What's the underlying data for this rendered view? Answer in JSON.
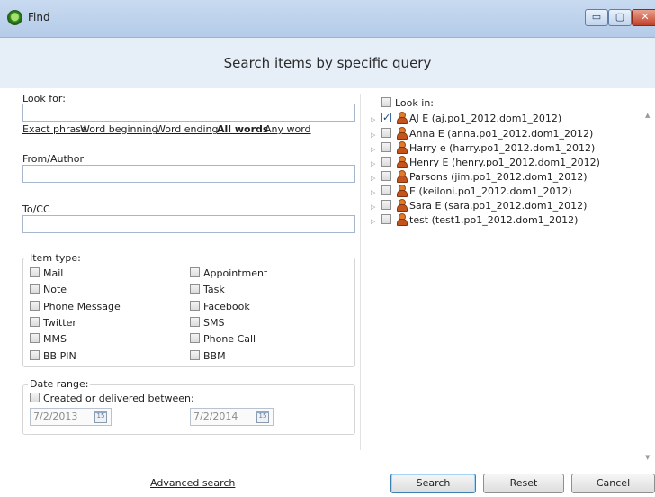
{
  "window": {
    "title": "Find"
  },
  "titlebar_buttons": {
    "minimize": "▭",
    "maximize": "▢",
    "close": "✕"
  },
  "heading": "Search items by specific query",
  "look_for": {
    "label": "Look for:",
    "value": ""
  },
  "match_options": [
    {
      "label": "Exact phrase",
      "selected": false
    },
    {
      "label": "Word beginning",
      "selected": false
    },
    {
      "label": "Word ending",
      "selected": false
    },
    {
      "label": "All words",
      "selected": true
    },
    {
      "label": "Any word",
      "selected": false
    }
  ],
  "from_author": {
    "label": "From/Author",
    "value": ""
  },
  "to_cc": {
    "label": "To/CC",
    "value": ""
  },
  "item_type": {
    "title": "Item type:",
    "items": [
      {
        "label": "Mail",
        "checked": false
      },
      {
        "label": "Appointment",
        "checked": false
      },
      {
        "label": "Note",
        "checked": false
      },
      {
        "label": "Task",
        "checked": false
      },
      {
        "label": "Phone Message",
        "checked": false
      },
      {
        "label": "Facebook",
        "checked": false
      },
      {
        "label": "Twitter",
        "checked": false
      },
      {
        "label": "SMS",
        "checked": false
      },
      {
        "label": "MMS",
        "checked": false
      },
      {
        "label": "Phone Call",
        "checked": false
      },
      {
        "label": "BB PIN",
        "checked": false
      },
      {
        "label": "BBM",
        "checked": false
      }
    ]
  },
  "date_range": {
    "title": "Date range:",
    "checkbox_label": "Created or delivered between:",
    "checked": false,
    "from": "7/2/2013",
    "to": "7/2/2014",
    "calendar_day": "15"
  },
  "look_in": {
    "label": "Look in:",
    "checked": false,
    "items": [
      {
        "label": "AJ E (aj.po1_2012.dom1_2012)",
        "checked": true
      },
      {
        "label": "Anna E (anna.po1_2012.dom1_2012)",
        "checked": false
      },
      {
        "label": "Harry e (harry.po1_2012.dom1_2012)",
        "checked": false
      },
      {
        "label": "Henry E (henry.po1_2012.dom1_2012)",
        "checked": false
      },
      {
        "label": "Parsons (jim.po1_2012.dom1_2012)",
        "checked": false
      },
      {
        "label": "E (keiloni.po1_2012.dom1_2012)",
        "checked": false
      },
      {
        "label": "Sara E (sara.po1_2012.dom1_2012)",
        "checked": false
      },
      {
        "label": "test (test1.po1_2012.dom1_2012)",
        "checked": false
      }
    ]
  },
  "advanced_search": "Advanced search",
  "buttons": {
    "search": "Search",
    "reset": "Reset",
    "cancel": "Cancel"
  },
  "icons": {
    "tree_expander": "▷",
    "scroll_up": "▲",
    "scroll_down": "▼"
  }
}
